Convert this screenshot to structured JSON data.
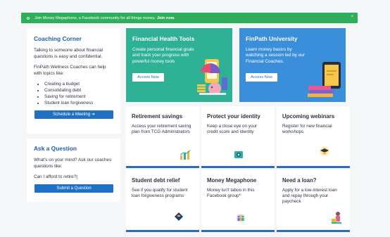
{
  "banner": {
    "text": "Join Money Megaphone, a Facebook community for all things money.",
    "cta": "Join now.",
    "close": "×"
  },
  "coaching": {
    "title": "Coaching Corner",
    "intro": "Talking to someone about financial questions is easy and confidential.",
    "help_text": "FinPath Wellness Coaches can help with topics like:",
    "topics": [
      "Creating a budget",
      "Consolidating debt",
      "Saving for retirement",
      "Student loan forgiveness"
    ],
    "button": "Schedule a Meeting ➔"
  },
  "question": {
    "title": "Ask a Question",
    "intro": "What's on your mind? Ask our coaches questions like:",
    "example": "Can I afford to retire?|",
    "button": "Submit a Question"
  },
  "heroes": [
    {
      "title": "Financial Health Tools",
      "desc": "Create personal financial goals and track your progress with powerful money tools",
      "button": "Access Now"
    },
    {
      "title": "FinPath University",
      "desc": "Learn money basics by watching a session led by our Financial Coaches.",
      "button": "Access Now"
    }
  ],
  "tiles": [
    {
      "title": "Retirement savings",
      "desc": "Access your retirement saving plan from TCG Administrators",
      "icon": "growth-chart-icon"
    },
    {
      "title": "Protect your identity",
      "desc": "Keep a close eye on your credit score and identity",
      "icon": "shield-icon"
    },
    {
      "title": "Upcoming webinars",
      "desc": "Register for new financial workshops",
      "icon": "graduation-cap-icon"
    },
    {
      "title": "Student debt relief",
      "desc": "See if you qualify for student loan forgiveness programs",
      "icon": "graduation-badge-icon"
    },
    {
      "title": "Money Megaphone",
      "desc": "Money isn't taboo in this Facebook group*",
      "icon": "community-icon"
    },
    {
      "title": "Need a loan?",
      "desc": "Apply for a low-interest loan and repay through your paycheck",
      "icon": "loan-person-icon"
    }
  ],
  "colors": {
    "banner": "#2fae5c",
    "title_blue": "#1f5faa",
    "button_blue": "#1f71c6",
    "hero_green": "#2fb195",
    "hero_blue": "#3b8fda"
  }
}
